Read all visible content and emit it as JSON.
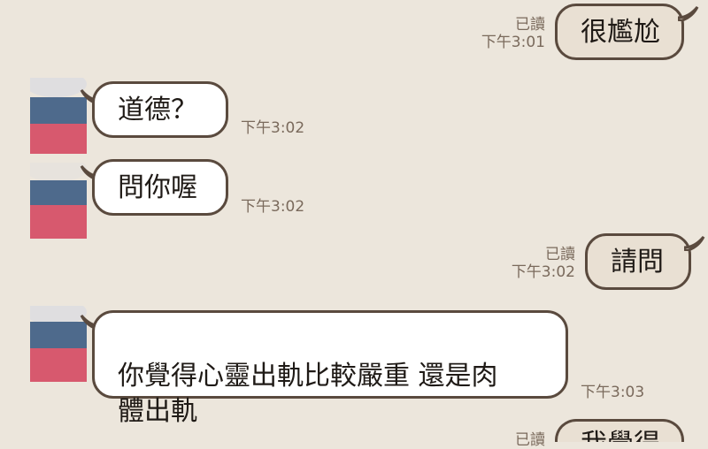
{
  "messages": [
    {
      "side": "out",
      "text": "很尷尬",
      "read": "已讀",
      "time": "下午3:01"
    },
    {
      "side": "in",
      "text": "道德？",
      "time": "下午3:02"
    },
    {
      "side": "in",
      "text": "問你喔",
      "time": "下午3:02"
    },
    {
      "side": "out",
      "text": "請問",
      "read": "已讀",
      "time": "下午3:02"
    },
    {
      "side": "in",
      "text": "你覺得心靈出軌比較嚴重 還是肉\n體出軌",
      "time": "下午3:03"
    },
    {
      "side": "out",
      "text": "我覺得",
      "read": "已讀"
    }
  ],
  "colors": {
    "background": "#ece6dc",
    "bubble_border": "#5a4a3e",
    "incoming_bubble": "#ffffff",
    "outgoing_bubble": "#e9e0d3",
    "meta_text": "#7a6a5c"
  }
}
